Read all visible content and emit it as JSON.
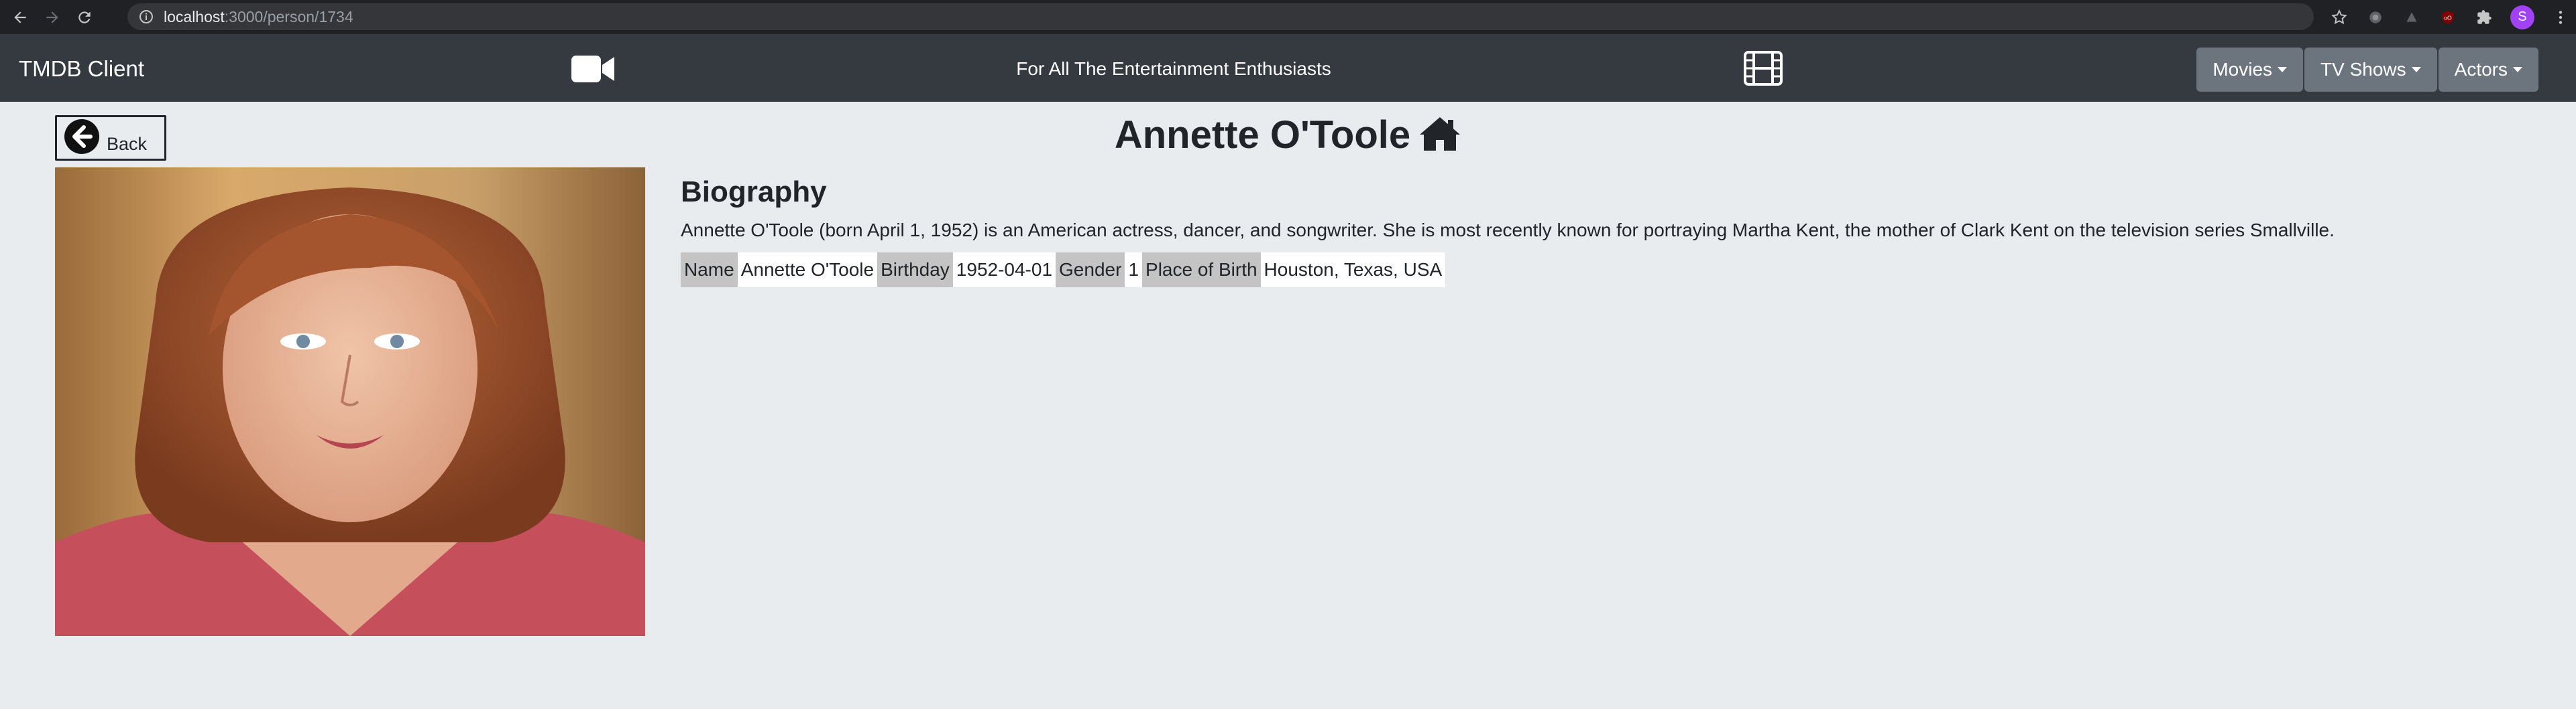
{
  "browser": {
    "url_host": "localhost",
    "url_path": ":3000/person/1734",
    "profile_initial": "S"
  },
  "navbar": {
    "brand": "TMDB Client",
    "tagline": "For All The Entertainment Enthusiasts",
    "menus": [
      "Movies",
      "TV Shows",
      "Actors"
    ]
  },
  "content": {
    "back_label": "Back",
    "title": "Annette O'Toole",
    "bio_heading": "Biography",
    "bio_text": "Annette O'Toole (born April 1, 1952) is an American actress, dancer, and songwriter. She is most recently known for portraying Martha Kent, the mother of Clark Kent on the television series Smallville.",
    "facts": [
      {
        "label": "Name",
        "value": "Annette O'Toole"
      },
      {
        "label": "Birthday",
        "value": "1952-04-01"
      },
      {
        "label": "Gender",
        "value": "1"
      },
      {
        "label": "Place of Birth",
        "value": "Houston, Texas, USA"
      }
    ]
  },
  "icons": {
    "back": "arrow-left-circle-icon",
    "camera": "video-camera-icon",
    "film": "film-icon",
    "home": "home-icon"
  }
}
